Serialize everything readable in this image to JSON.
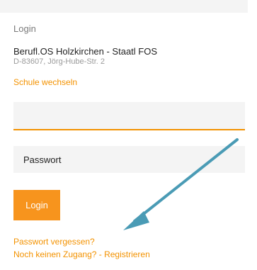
{
  "login": {
    "section_title": "Login",
    "school_name": "Berufl.OS Holzkirchen - Staatl FOS",
    "school_address": "D-83607, Jörg-Hube-Str. 2",
    "change_school_link": "Schule wechseln",
    "username_value": "",
    "password_placeholder": "Passwort",
    "login_button_label": "Login",
    "forgot_password_link": "Passwort vergessen?",
    "register_link": "Noch keinen Zugang? - Registrieren"
  },
  "annotation": {
    "arrow_icon": "pointer-arrow-icon",
    "arrow_color": "#4a9bb5"
  },
  "colors": {
    "accent": "#f39200",
    "button": "#f7941d",
    "field_background": "#f4f4f4"
  }
}
